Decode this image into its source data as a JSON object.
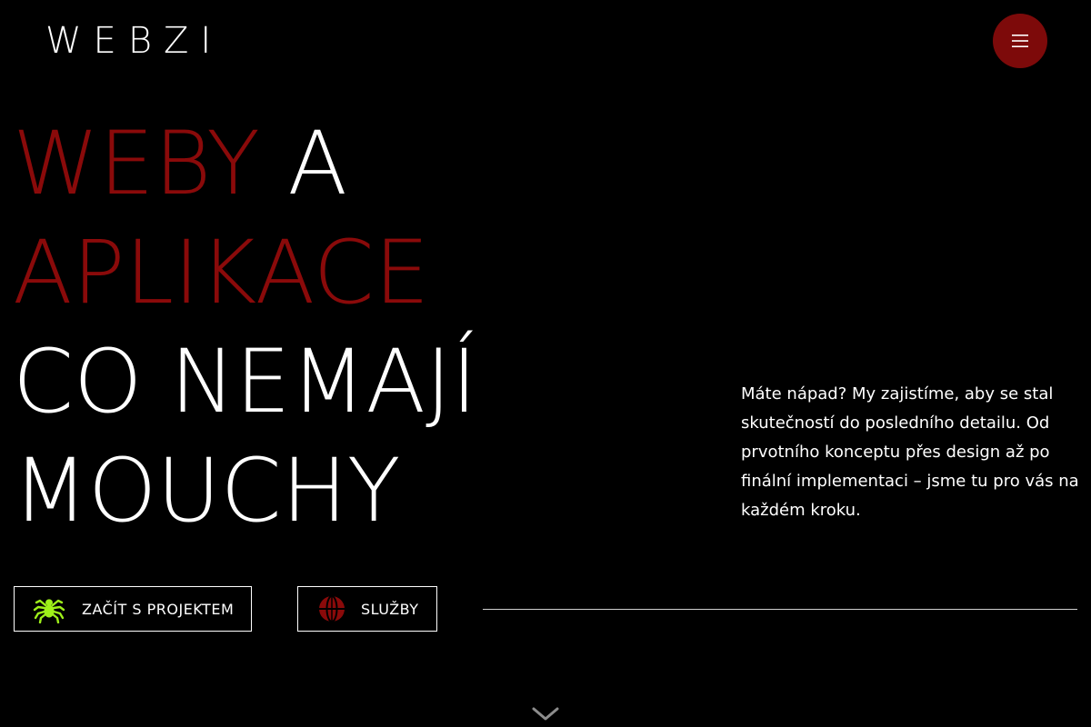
{
  "header": {
    "logo_text": "WEBZI",
    "menu_button_icon": "hamburger-icon"
  },
  "hero": {
    "headline": {
      "line1_accent": "WEBY",
      "line1_plain": " A",
      "line2_accent": "APLIKACE",
      "line3": "CO NEMAJÍ",
      "line4": "MOUCHY"
    },
    "intro": "Máte nápad? My zajistíme, aby se stal skutečností do posledního detailu. Od prvotního konceptu přes design až po finální implementaci – jsme tu pro vás na každém kroku.",
    "primary_button": {
      "label": "ZAČÍT S PROJEKTEM",
      "icon": "spider-icon"
    },
    "secondary_button": {
      "label": "SLUŽBY",
      "icon": "globe-icon"
    },
    "scroll_icon": "chevron-down-icon"
  },
  "colors": {
    "background": "#000000",
    "accent": "#8a0a0a",
    "menu_button": "#7d0a0a",
    "spider_icon": "#9ef01a",
    "text": "#ffffff"
  }
}
